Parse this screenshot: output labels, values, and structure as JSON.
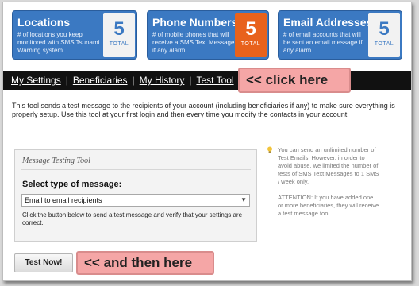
{
  "stats": [
    {
      "name": "Locations",
      "description": "# of locations you keep monitored with SMS Tsunami Warning system.",
      "count": "5",
      "unit": "TOTAL"
    },
    {
      "name": "Phone Numbers",
      "description": "# of mobile phones that will receive a SMS Text Message if any alarm.",
      "count": "5",
      "unit": "TOTAL"
    },
    {
      "name": "Email Addresses",
      "description": "# of email accounts that will be sent an email message if any alarm.",
      "count": "5",
      "unit": "TOTAL"
    }
  ],
  "nav": {
    "items": [
      "My Settings",
      "Beneficiaries",
      "My History",
      "Test Tool"
    ],
    "separator": "|"
  },
  "callouts": {
    "first": "<< click here",
    "second": "<< and then here"
  },
  "intro": "This tool sends a test message to the recipients of your account (including beneficiaries if any) to make sure everything is properly setup. Use this tool at your first login and then every time you modify the contacts in your account.",
  "tool": {
    "title": "Message Testing Tool",
    "select_label": "Select type of message:",
    "select_value": "Email to email recipients",
    "help": "Click the button below to send a test message and verify that your settings are correct."
  },
  "tip": {
    "paragraph1": "You can send an unlimited number of Test Emails. However, in order to avoid abuse, we limited the number of tests of SMS Text Messages to 1 SMS / week only.",
    "paragraph2": "ATTENTION: If you have added one or more beneficiaries, they will receive a test message too."
  },
  "button": {
    "label": "Test Now!"
  },
  "colors": {
    "stat_blue": "#3b79c2",
    "stat_orange": "#e8621c",
    "callout_pink": "#f5a6a6",
    "navbar": "#111111"
  }
}
